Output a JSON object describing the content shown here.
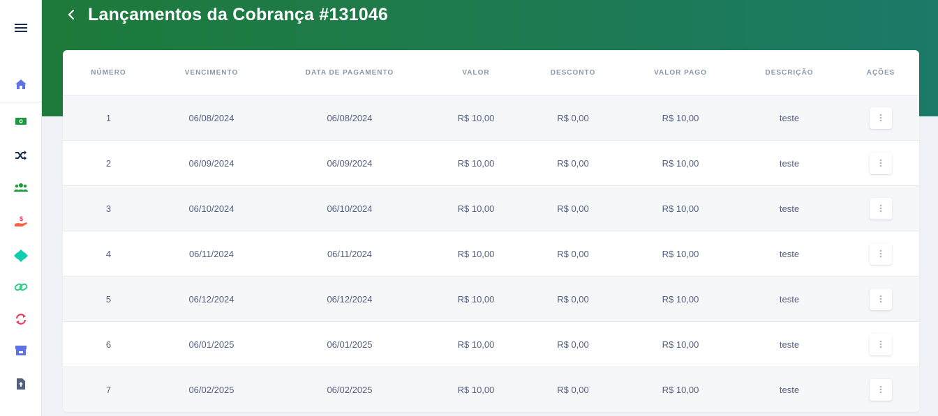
{
  "page": {
    "title": "Lançamentos da Cobrança #131046"
  },
  "sidebar": {
    "menu_icon": "hamburger-menu-icon",
    "items": [
      {
        "name": "home",
        "icon": "home-icon",
        "color": "#5e72e4"
      },
      {
        "name": "money",
        "icon": "money-bill-icon",
        "color": "#2dce89"
      },
      {
        "name": "shuffle",
        "icon": "shuffle-icon",
        "color": "#172b4d"
      },
      {
        "name": "users",
        "icon": "users-icon",
        "color": "#1a9a3c"
      },
      {
        "name": "receive-payment",
        "icon": "hand-dollar-icon",
        "color": "#f5365c"
      },
      {
        "name": "pix",
        "icon": "pix-diamond-icon",
        "color": "#11cdaf"
      },
      {
        "name": "link",
        "icon": "link-icon",
        "color": "#2dce89"
      },
      {
        "name": "recurring",
        "icon": "sync-icon",
        "color": "#f5365c"
      },
      {
        "name": "store",
        "icon": "store-icon",
        "color": "#5e72e4"
      },
      {
        "name": "upload-file",
        "icon": "file-upload-icon",
        "color": "#525f7f"
      }
    ]
  },
  "table": {
    "headers": [
      "NÚMERO",
      "VENCIMENTO",
      "DATA DE PAGAMENTO",
      "VALOR",
      "DESCONTO",
      "VALOR PAGO",
      "DESCRIÇÃO",
      "AÇÕES"
    ],
    "rows": [
      {
        "numero": "1",
        "vencimento": "06/08/2024",
        "data_pagamento": "06/08/2024",
        "valor": "R$ 10,00",
        "desconto": "R$ 0,00",
        "valor_pago": "R$ 10,00",
        "descricao": "teste"
      },
      {
        "numero": "2",
        "vencimento": "06/09/2024",
        "data_pagamento": "06/09/2024",
        "valor": "R$ 10,00",
        "desconto": "R$ 0,00",
        "valor_pago": "R$ 10,00",
        "descricao": "teste"
      },
      {
        "numero": "3",
        "vencimento": "06/10/2024",
        "data_pagamento": "06/10/2024",
        "valor": "R$ 10,00",
        "desconto": "R$ 0,00",
        "valor_pago": "R$ 10,00",
        "descricao": "teste"
      },
      {
        "numero": "4",
        "vencimento": "06/11/2024",
        "data_pagamento": "06/11/2024",
        "valor": "R$ 10,00",
        "desconto": "R$ 0,00",
        "valor_pago": "R$ 10,00",
        "descricao": "teste"
      },
      {
        "numero": "5",
        "vencimento": "06/12/2024",
        "data_pagamento": "06/12/2024",
        "valor": "R$ 10,00",
        "desconto": "R$ 0,00",
        "valor_pago": "R$ 10,00",
        "descricao": "teste"
      },
      {
        "numero": "6",
        "vencimento": "06/01/2025",
        "data_pagamento": "06/01/2025",
        "valor": "R$ 10,00",
        "desconto": "R$ 0,00",
        "valor_pago": "R$ 10,00",
        "descricao": "teste"
      },
      {
        "numero": "7",
        "vencimento": "06/02/2025",
        "data_pagamento": "06/02/2025",
        "valor": "R$ 10,00",
        "desconto": "R$ 0,00",
        "valor_pago": "R$ 10,00",
        "descricao": "teste"
      }
    ],
    "action_icon": "vertical-ellipsis-icon"
  },
  "colors": {
    "header_gradient_start": "#1d7a3a",
    "header_gradient_end": "#1b7a68",
    "text_muted": "#8898aa",
    "text_body": "#525f7f"
  }
}
